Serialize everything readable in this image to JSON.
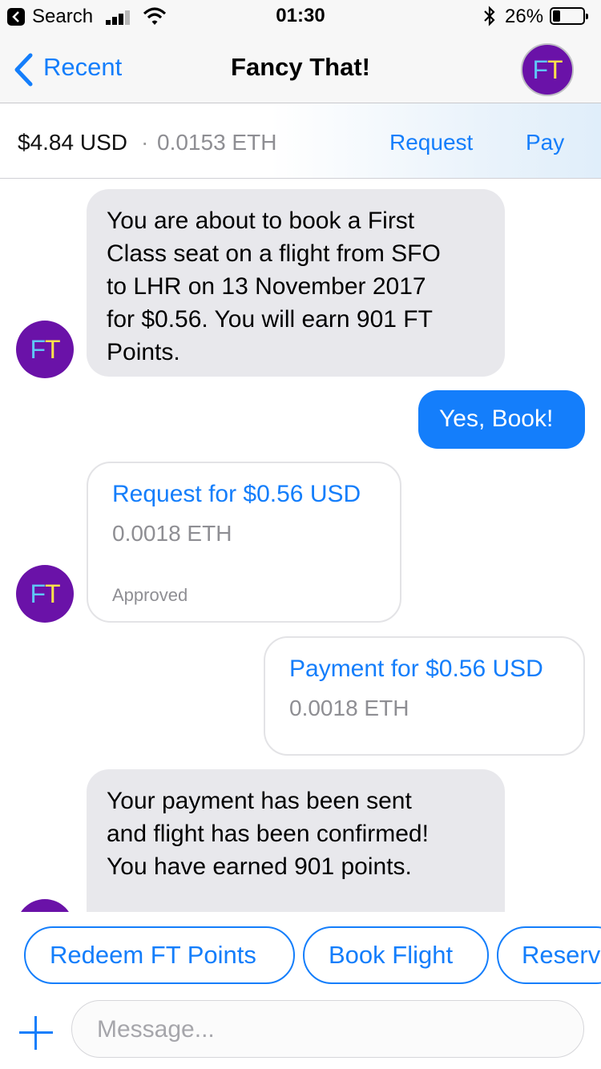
{
  "status_bar": {
    "back_app": "Search",
    "time": "01:30",
    "battery": "26%",
    "battery_level": 0.26
  },
  "nav": {
    "back_label": "Recent",
    "title": "Fancy That!",
    "avatar_initials": {
      "f": "F",
      "t": "T"
    }
  },
  "balance": {
    "usd": "$4.84 USD",
    "separator": "·",
    "eth": "0.0153 ETH",
    "request_label": "Request",
    "pay_label": "Pay"
  },
  "messages": {
    "m1": {
      "from": "bot",
      "lines": [
        "You are about to book a First",
        "Class seat on a flight from SFO",
        "to LHR on 13 November 2017",
        "for $0.56. You will earn 901 FT",
        "Points."
      ]
    },
    "m2": {
      "from": "user",
      "text": "Yes, Book!"
    },
    "m3": {
      "from": "bot",
      "type": "payment-request",
      "title": "Request for $0.56 USD",
      "eth": "0.0018 ETH",
      "status": "Approved"
    },
    "m4": {
      "from": "user",
      "type": "payment",
      "title": "Payment for $0.56 USD",
      "eth": "0.0018 ETH"
    },
    "m5": {
      "from": "bot",
      "lines": [
        "Your payment has been sent",
        "and flight has been confirmed!",
        "You have earned 901 points."
      ]
    }
  },
  "quick_replies": [
    "Redeem FT Points",
    "Book Flight",
    "Reserv"
  ],
  "composer": {
    "placeholder": "Message..."
  },
  "colors": {
    "accent": "#147efb",
    "brand_purple": "#6a12a8",
    "logo_f": "#5fc7f5",
    "logo_t": "#ffe24a",
    "incoming_bubble": "#e8e8ec"
  },
  "icons": [
    "back-app-icon",
    "signal-icon",
    "wifi-icon",
    "bluetooth-icon",
    "battery-icon",
    "chevron-left-icon",
    "plus-icon"
  ]
}
